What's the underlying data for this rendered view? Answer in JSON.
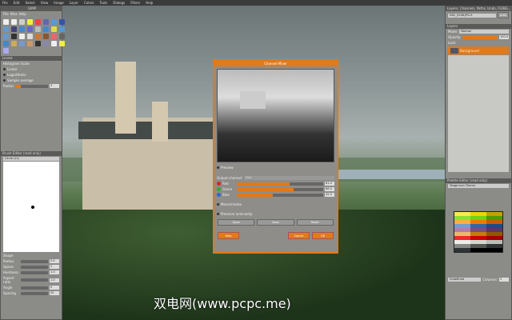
{
  "menubar": [
    "File",
    "Edit",
    "Select",
    "View",
    "Image",
    "Layer",
    "Colors",
    "Tools",
    "Dialogs",
    "Filters",
    "Help"
  ],
  "toolbox": {
    "title": "GIMP",
    "menu": [
      "File",
      "Xtns",
      "Help"
    ],
    "tool_colors": [
      "#eee",
      "#eee",
      "#ccc",
      "#ee4",
      "#e44",
      "#66a",
      "#59d",
      "#35a",
      "#69c",
      "#447",
      "#48c",
      "#66c",
      "#bbb",
      "#48c",
      "#dd4",
      "#59c",
      "#69c",
      "#333",
      "#eee",
      "#ddd",
      "#c73",
      "#853",
      "#e66",
      "#666",
      "#48c",
      "#ca6",
      "#79c",
      "#c96",
      "#333",
      "#88a",
      "#eee",
      "#ee4",
      "#aae"
    ]
  },
  "levels": {
    "title": "Levels",
    "histogram_scale": "Histogram Scale",
    "linear": "Linear",
    "logarithmic": "Logarithmic",
    "sample_average": "Sample average",
    "radius_label": "Radius",
    "radius_value": "3"
  },
  "brush_editor": {
    "title": "Brush Editor (read only)",
    "brush_name": "Circle (11)",
    "shape": "Shape",
    "params": [
      {
        "label": "Radius",
        "value": "5.5"
      },
      {
        "label": "Spikes",
        "value": "2"
      },
      {
        "label": "Hardness",
        "value": "1.0"
      },
      {
        "label": "Aspect ratio",
        "value": "1.0"
      },
      {
        "label": "Angle",
        "value": "0"
      },
      {
        "label": "Spacing",
        "value": "20"
      }
    ]
  },
  "layers": {
    "tabs": "Layers, Channels, Paths, Undo, FG/BG...",
    "image": "DSC_0248.JPG-5",
    "auto": "Auto",
    "title": "Layers",
    "mode_label": "Mode:",
    "mode": "Normal",
    "opacity_label": "Opacity:",
    "opacity": "100.0",
    "lock_label": "Lock:",
    "layer_name": "Background"
  },
  "palette": {
    "title": "Palette Editor (read only)",
    "name": "Tango Icon Theme",
    "color_name": "Undefined",
    "columns_label": "Columns:",
    "columns": "3",
    "swatches": [
      "#fce94f",
      "#edd400",
      "#c4a000",
      "#8ae234",
      "#73d216",
      "#4e9a06",
      "#fcaf3e",
      "#f57900",
      "#ce5c00",
      "#729fcf",
      "#3465a4",
      "#204a87",
      "#ad7fa8",
      "#75507b",
      "#5c3566",
      "#e9b96e",
      "#c17d11",
      "#8f5902",
      "#ef2929",
      "#cc0000",
      "#a40000",
      "#eeeeec",
      "#d3d7cf",
      "#babdb6",
      "#888a85",
      "#555753",
      "#2e3436",
      "#2e3436",
      "#000000",
      "#000000"
    ]
  },
  "dialog": {
    "title": "Channel Mixer",
    "preview": "Preview",
    "output_label": "Output channel:",
    "output": "Red",
    "channels": [
      {
        "name": "Red",
        "value": "61.0",
        "fill": 61,
        "color": "#d22"
      },
      {
        "name": "Green",
        "value": "66.0",
        "fill": 66,
        "color": "#3a3"
      },
      {
        "name": "Blue",
        "value": "42.0",
        "fill": 42,
        "color": "#36c"
      }
    ],
    "monochrome": "Monochrome",
    "preserve": "Preserve luminosity",
    "open": "Open",
    "save": "Save",
    "reset": "Reset",
    "help": "Help",
    "cancel": "Cancel",
    "ok": "OK"
  },
  "watermark": "双电网(www.pcpc.me)"
}
